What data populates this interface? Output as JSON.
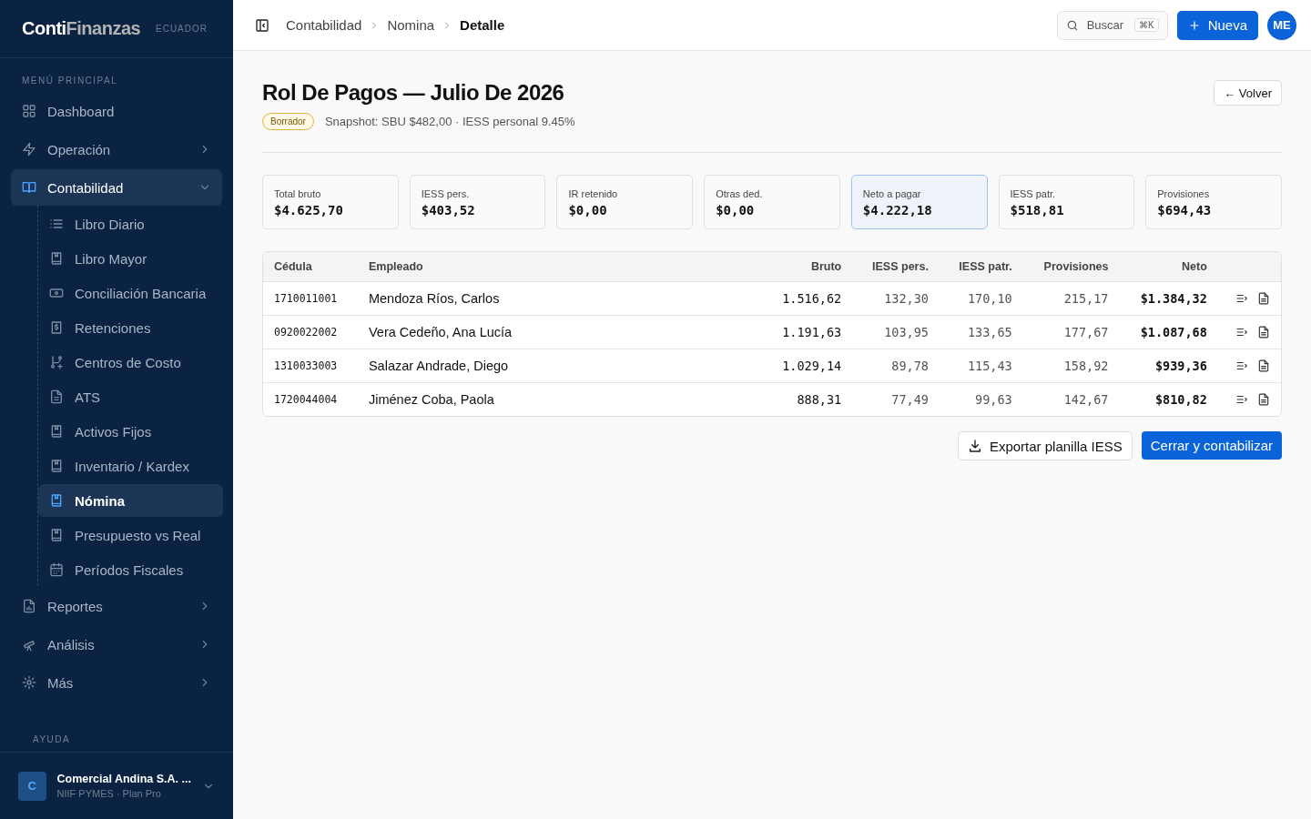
{
  "sidebar": {
    "logo": {
      "part_1": "Conti",
      "part_2": "Finanzas"
    },
    "country": "ECUADOR",
    "section_title": "MENÚ PRINCIPAL",
    "items": [
      {
        "label": "Dashboard",
        "kind": "link",
        "selected": false
      },
      {
        "label": "Operación",
        "kind": "group",
        "expanded": false,
        "selected": false
      },
      {
        "label": "Contabilidad",
        "kind": "group",
        "expanded": true,
        "selected": true,
        "children": [
          {
            "label": "Libro Diario",
            "selected": false
          },
          {
            "label": "Libro Mayor",
            "selected": false
          },
          {
            "label": "Conciliación Bancaria",
            "selected": false
          },
          {
            "label": "Retenciones",
            "selected": false
          },
          {
            "label": "Centros de Costo",
            "selected": false
          },
          {
            "label": "ATS",
            "selected": false
          },
          {
            "label": "Activos Fijos",
            "selected": false
          },
          {
            "label": "Inventario / Kardex",
            "selected": false
          },
          {
            "label": "Nómina",
            "selected": true
          },
          {
            "label": "Presupuesto vs Real",
            "selected": false
          },
          {
            "label": "Períodos Fiscales",
            "selected": false
          }
        ]
      },
      {
        "label": "Reportes",
        "kind": "group",
        "expanded": false,
        "selected": false
      },
      {
        "label": "Análisis",
        "kind": "group",
        "expanded": false,
        "selected": false
      },
      {
        "label": "Más",
        "kind": "group",
        "expanded": false,
        "selected": false
      }
    ],
    "help_title": "AYUDA",
    "company": {
      "initial": "C",
      "name": "Comercial Andina S.A. ...",
      "plan": "NIIF PYMES · Plan Pro"
    }
  },
  "topbar": {
    "breadcrumbs": [
      "Contabilidad",
      "Nomina",
      "Detalle"
    ],
    "search": {
      "placeholder": "Buscar",
      "shortcut": "⌘K"
    },
    "new_button": "Nueva",
    "avatar": "ME"
  },
  "page": {
    "title": "Rol De Pagos — Julio De 2026",
    "status": "Borrador",
    "snapshot": "Snapshot: SBU $482,00 · IESS personal 9.45%",
    "back_button": "← Volver"
  },
  "stats": [
    {
      "label": "Total bruto",
      "value": "$4.625,70",
      "selected": false
    },
    {
      "label": "IESS pers.",
      "value": "$403,52",
      "selected": false
    },
    {
      "label": "IR retenido",
      "value": "$0,00",
      "selected": false
    },
    {
      "label": "Otras ded.",
      "value": "$0,00",
      "selected": false
    },
    {
      "label": "Neto a pagar",
      "value": "$4.222,18",
      "selected": true
    },
    {
      "label": "IESS patr.",
      "value": "$518,81",
      "selected": false
    },
    {
      "label": "Provisiones",
      "value": "$694,43",
      "selected": false
    }
  ],
  "table": {
    "columns": [
      "Cédula",
      "Empleado",
      "Bruto",
      "IESS pers.",
      "IESS patr.",
      "Provisiones",
      "Neto"
    ],
    "rows": [
      [
        "1710011001",
        "Mendoza Ríos, Carlos",
        "1.516,62",
        "132,30",
        "170,10",
        "215,17",
        "$1.384,32"
      ],
      [
        "0920022002",
        "Vera Cedeño, Ana Lucía",
        "1.191,63",
        "103,95",
        "133,65",
        "177,67",
        "$1.087,68"
      ],
      [
        "1310033003",
        "Salazar Andrade, Diego",
        "1.029,14",
        "89,78",
        "115,43",
        "158,92",
        "$939,36"
      ],
      [
        "1720044004",
        "Jiménez Coba, Paola",
        "888,31",
        "77,49",
        "99,63",
        "142,67",
        "$810,82"
      ]
    ]
  },
  "actions": {
    "export_button": "Exportar planilla IESS",
    "close_button": "Cerrar y contabilizar"
  }
}
